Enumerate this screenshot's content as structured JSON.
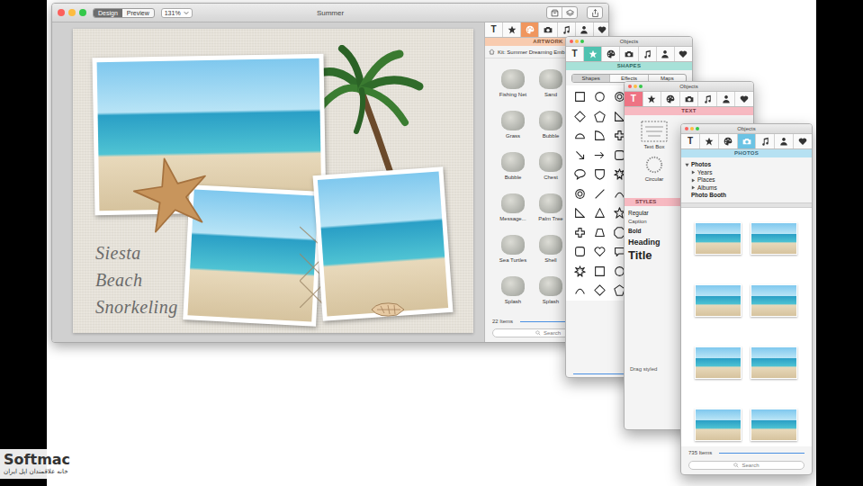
{
  "window": {
    "title": "Summer",
    "mode_tabs": [
      {
        "label": "Design",
        "selected": true
      },
      {
        "label": "Preview",
        "selected": false
      }
    ],
    "zoom": "131%"
  },
  "canvas": {
    "caption_lines": [
      "Siesta",
      "Beach",
      "Snorkeling"
    ]
  },
  "sidebar": {
    "color": "#f0965e",
    "tabs": [
      {
        "kind": "text",
        "label": "T",
        "selected": false
      },
      {
        "kind": "star",
        "selected": false
      },
      {
        "kind": "palette",
        "selected": true
      },
      {
        "kind": "camera",
        "selected": false
      },
      {
        "kind": "music",
        "selected": false
      },
      {
        "kind": "person",
        "selected": false
      },
      {
        "kind": "heart",
        "selected": false
      }
    ],
    "header": "ARTWORK",
    "breadcrumb": "Kit: Summer Dreaming Emb",
    "items": [
      {
        "label": "Fishing Net"
      },
      {
        "label": "Sand"
      },
      {
        "label": "Grass"
      },
      {
        "label": "Bubble"
      },
      {
        "label": "Bubble"
      },
      {
        "label": "Chest"
      },
      {
        "label": "Message..."
      },
      {
        "label": "Palm Tree"
      },
      {
        "label": "Sea Turtles"
      },
      {
        "label": "Shell"
      },
      {
        "label": "Splash"
      },
      {
        "label": "Splash"
      }
    ],
    "count": "22 Items",
    "search": {
      "placeholder": "Search"
    }
  },
  "panels": [
    {
      "kind": "shapes",
      "title": "Objects",
      "color": "#4fc2b0",
      "tabs": [
        {
          "kind": "text",
          "label": "T",
          "selected": false
        },
        {
          "kind": "star",
          "selected": true
        },
        {
          "kind": "palette",
          "selected": false
        },
        {
          "kind": "camera",
          "selected": false
        },
        {
          "kind": "music",
          "selected": false
        },
        {
          "kind": "person",
          "selected": false
        },
        {
          "kind": "heart",
          "selected": false
        }
      ],
      "header": "SHAPES",
      "segments": [
        {
          "label": "Shapes",
          "selected": true
        },
        {
          "label": "Effects",
          "selected": false
        },
        {
          "label": "Maps",
          "selected": false
        }
      ]
    },
    {
      "kind": "text",
      "title": "Objects",
      "color": "#ee7383",
      "tabs": [
        {
          "kind": "text",
          "label": "T",
          "selected": true
        },
        {
          "kind": "star",
          "selected": false
        },
        {
          "kind": "palette",
          "selected": false
        },
        {
          "kind": "camera",
          "selected": false
        },
        {
          "kind": "music",
          "selected": false
        },
        {
          "kind": "person",
          "selected": false
        },
        {
          "kind": "heart",
          "selected": false
        }
      ],
      "header": "TEXT",
      "items": [
        {
          "label": "Text Box",
          "kind": "box"
        },
        {
          "label": "Circular",
          "kind": "circular"
        }
      ],
      "styles_header": "STYLES",
      "styles": [
        {
          "label": "Regular",
          "kind": "regular"
        },
        {
          "label": "Caption",
          "kind": "caption"
        },
        {
          "label": "Bold",
          "kind": "bold"
        },
        {
          "label": "Heading",
          "kind": "heading"
        },
        {
          "label": "Title",
          "kind": "title"
        }
      ],
      "hint": "Drag styled"
    },
    {
      "kind": "photos",
      "title": "Objects",
      "color": "#6cc3e4",
      "tabs": [
        {
          "kind": "text",
          "label": "T",
          "selected": false
        },
        {
          "kind": "star",
          "selected": false
        },
        {
          "kind": "palette",
          "selected": false
        },
        {
          "kind": "camera",
          "selected": true
        },
        {
          "kind": "music",
          "selected": false
        },
        {
          "kind": "person",
          "selected": false
        },
        {
          "kind": "heart",
          "selected": false
        }
      ],
      "header": "PHOTOS",
      "tree": [
        {
          "label": "Photos",
          "expanded": true,
          "children": [
            {
              "label": "Years",
              "expanded": false
            },
            {
              "label": "Places",
              "expanded": false
            },
            {
              "label": "Albums",
              "expanded": false
            }
          ]
        },
        {
          "label": "Photo Booth"
        }
      ],
      "photos": [
        {
          "selected": false
        },
        {
          "selected": false
        },
        {
          "selected": false
        },
        {
          "selected": false
        },
        {
          "selected": false
        },
        {
          "selected": false
        },
        {
          "selected": false
        },
        {
          "selected": false
        }
      ],
      "count": "735 Items",
      "search": {
        "placeholder": "Search"
      }
    }
  ],
  "watermark": {
    "brand": "Softmac",
    "tagline": "خانه علاقمندان اپل ایران"
  }
}
